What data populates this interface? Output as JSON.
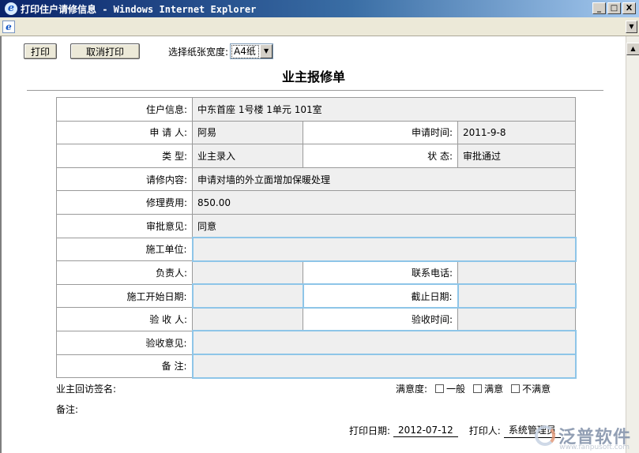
{
  "window": {
    "title": "打印住户请修信息 - Windows Internet Explorer",
    "minimize": "_",
    "maximize": "□",
    "close": "X"
  },
  "toolbar": {
    "print_label": "打印",
    "cancel_print_label": "取消打印",
    "paper_width_label": "选择纸张宽度:",
    "paper_width_value": "A4纸"
  },
  "document": {
    "title": "业主报修单"
  },
  "form": {
    "resident_info_label": "住户信息:",
    "resident_info_value": "中东首座 1号楼 1单元 101室",
    "applicant_label": "申 请 人:",
    "applicant_value": "阿易",
    "apply_time_label": "申请时间:",
    "apply_time_value": "2011-9-8",
    "type_label": "类    型:",
    "type_value": "业主录入",
    "status_label": "状    态:",
    "status_value": "审批通过",
    "repair_content_label": "请修内容:",
    "repair_content_value": "申请对墙的外立面增加保暖处理",
    "repair_cost_label": "修理费用:",
    "repair_cost_value": "850.00",
    "approval_opinion_label": "审批意见:",
    "approval_opinion_value": "同意",
    "construction_unit_label": "施工单位:",
    "construction_unit_value": "",
    "person_in_charge_label": "负责人:",
    "person_in_charge_value": "",
    "contact_phone_label": "联系电话:",
    "contact_phone_value": "",
    "start_date_label": "施工开始日期:",
    "start_date_value": "",
    "end_date_label": "截止日期:",
    "end_date_value": "",
    "inspector_label": "验 收 人:",
    "inspector_value": "",
    "inspection_time_label": "验收时间:",
    "inspection_time_value": "",
    "inspection_opinion_label": "验收意见:",
    "inspection_opinion_value": "",
    "remarks_label": "备    注:",
    "remarks_value": ""
  },
  "footer": {
    "owner_signature_label": "业主回访签名:",
    "satisfaction_label": "满意度:",
    "options": [
      "一般",
      "满意",
      "不满意"
    ],
    "remarks_label": "备注:",
    "print_date_label": "打印日期:",
    "print_date_value": "2012-07-12",
    "printer_label": "打印人:",
    "printer_value": "系统管理员"
  },
  "watermark": {
    "brand": "泛普软件",
    "url": "www.fanpusoft.com"
  }
}
